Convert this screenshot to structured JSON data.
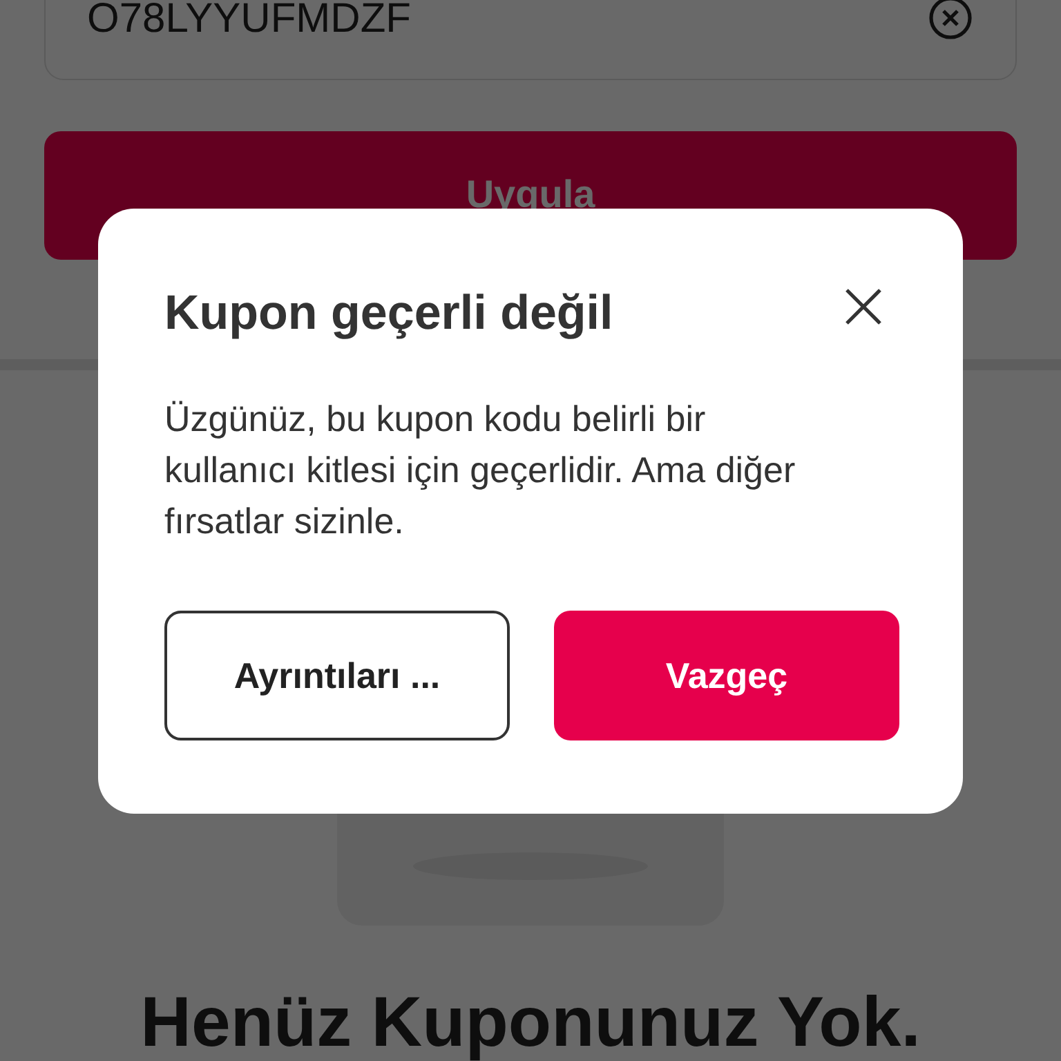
{
  "coupon_field": {
    "value": "O78LYYUFMDZF"
  },
  "apply_button": {
    "label": "Uygula"
  },
  "empty_state": {
    "kind": "picture",
    "heading": "Henüz Kuponunuz Yok."
  },
  "dialog": {
    "title": "Kupon geçerli değil",
    "message": "Üzgünüz, bu kupon kodu belirli bir kullanıcı kitlesi için geçerlidir. Ama diğer fırsatlar sizinle.",
    "buttons": [
      {
        "label": "Ayrıntıları ...",
        "kind": "secondary"
      },
      {
        "label": "Vazgeç",
        "kind": "primary"
      }
    ]
  }
}
